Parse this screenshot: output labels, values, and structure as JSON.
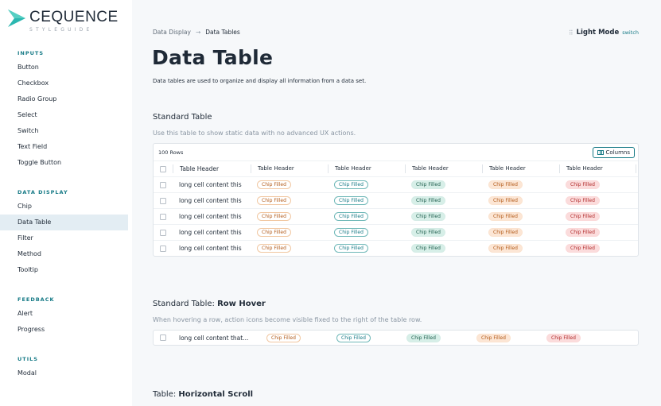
{
  "brand": {
    "name": "CEQUENCE",
    "sub": "STYLEGUIDE",
    "color": "#2bb7b0"
  },
  "nav": {
    "inputs": {
      "heading": "INPUTS",
      "items": [
        "Button",
        "Checkbox",
        "Radio Group",
        "Select",
        "Switch",
        "Text Field",
        "Toggle Button"
      ]
    },
    "data_display": {
      "heading": "DATA DISPLAY",
      "items": [
        "Chip",
        "Data Table",
        "Filter",
        "Method",
        "Tooltip"
      ],
      "active": "Data Table"
    },
    "feedback": {
      "heading": "FEEDBACK",
      "items": [
        "Alert",
        "Progress"
      ]
    },
    "utils": {
      "heading": "UTILS",
      "items": [
        "Modal"
      ]
    }
  },
  "breadcrumb": {
    "parent": "Data Display",
    "separator": "→",
    "current": "Data Tables"
  },
  "mode": {
    "icon": "grid-icon",
    "label": "Light Mode",
    "switch": "switch"
  },
  "page": {
    "title": "Data Table",
    "description": "Data tables are used to organize and display all information from a data set."
  },
  "standard": {
    "title": "Standard Table",
    "description": "Use this table to show static data with no advanced UX actions.",
    "rows_label": "100 Rows",
    "columns_button": "Columns",
    "headers": [
      "Table Header",
      "Table Header",
      "Table Header",
      "Table Header",
      "Table Header",
      "Table Header"
    ],
    "rows": [
      {
        "text": "long cell content this",
        "chips": [
          "Chip Filled",
          "Chip Filled",
          "Chip Filled",
          "Chip Filled",
          "Chip Filled"
        ]
      },
      {
        "text": "long cell content this",
        "chips": [
          "Chip Filled",
          "Chip Filled",
          "Chip Filled",
          "Chip Filled",
          "Chip Filled"
        ]
      },
      {
        "text": "long cell content this",
        "chips": [
          "Chip Filled",
          "Chip Filled",
          "Chip Filled",
          "Chip Filled",
          "Chip Filled"
        ]
      },
      {
        "text": "long cell content this",
        "chips": [
          "Chip Filled",
          "Chip Filled",
          "Chip Filled",
          "Chip Filled",
          "Chip Filled"
        ]
      },
      {
        "text": "long cell content this",
        "chips": [
          "Chip Filled",
          "Chip Filled",
          "Chip Filled",
          "Chip Filled",
          "Chip Filled"
        ]
      }
    ]
  },
  "hover": {
    "title_prefix": "Standard Table: ",
    "title_bold": "Row Hover",
    "description": "When hovering a row, action icons become visible fixed to the right of the table row.",
    "row": {
      "text": "long cell content that...",
      "chips": [
        "Chip Filled",
        "Chip Filled",
        "Chip Filled",
        "Chip Filled",
        "Chip Filled"
      ]
    }
  },
  "scroll": {
    "title_prefix": "Table: ",
    "title_bold": "Horizontal Scroll"
  }
}
